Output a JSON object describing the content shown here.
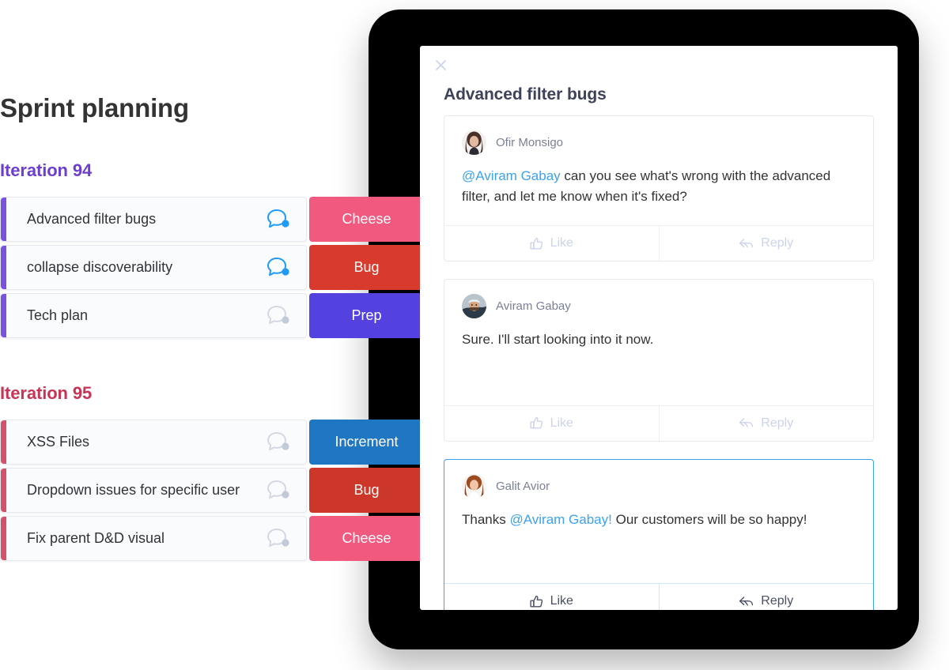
{
  "board": {
    "title": "Sprint planning",
    "groups": [
      {
        "title": "Iteration 94",
        "color": "#6c3fd1",
        "stripe": "#7b51e0",
        "tasks": [
          {
            "name": "Advanced filter bugs",
            "bubble": "chat-bubble-icon",
            "bubble_state": "active",
            "tag": "Cheese",
            "tag_color": "#f1597e"
          },
          {
            "name": "collapse discoverability",
            "bubble": "chat-bubble-icon",
            "bubble_state": "active",
            "tag": "Bug",
            "tag_color": "#d93a2e"
          },
          {
            "name": "Tech plan",
            "bubble": "chat-bubble-icon",
            "bubble_state": "muted",
            "tag": "Prep",
            "tag_color": "#5342e0"
          }
        ]
      },
      {
        "title": "Iteration 95",
        "color": "#c83454",
        "stripe": "#d4516a",
        "tasks": [
          {
            "name": "XSS Files",
            "bubble": "chat-bubble-icon",
            "bubble_state": "muted",
            "tag": "Increment",
            "tag_color": "#1f76c2"
          },
          {
            "name": "Dropdown issues for specific user",
            "bubble": "chat-bubble-icon",
            "bubble_state": "muted",
            "tag": "Bug",
            "tag_color": "#cc3729"
          },
          {
            "name": "Fix parent D&D visual",
            "bubble": "chat-bubble-icon",
            "bubble_state": "muted",
            "tag": "Cheese",
            "tag_color": "#f1597e"
          }
        ]
      }
    ]
  },
  "modal": {
    "close_label": "×",
    "title": "Advanced filter bugs",
    "accent_color": "#3aa3f4",
    "comments": [
      {
        "author": "Ofir Monsigo",
        "avatar": "avatar-ofir",
        "text_before": "",
        "mention": "@Aviram Gabay",
        "text_after": " can you see what's wrong with the advanced filter, and let me know when it's fixed?",
        "like_label": "Like",
        "reply_label": "Reply",
        "highlighted": false
      },
      {
        "author": "Aviram Gabay",
        "avatar": "avatar-aviram",
        "text_before": "Sure. I'll start looking into it now.",
        "mention": "",
        "text_after": "",
        "like_label": "Like",
        "reply_label": "Reply",
        "highlighted": false
      },
      {
        "author": "Galit Avior",
        "avatar": "avatar-galit",
        "text_before": "Thanks ",
        "mention": "@Aviram Gabay!",
        "text_after": " Our customers will be so happy!",
        "like_label": "Like",
        "reply_label": "Reply",
        "highlighted": true
      }
    ]
  }
}
